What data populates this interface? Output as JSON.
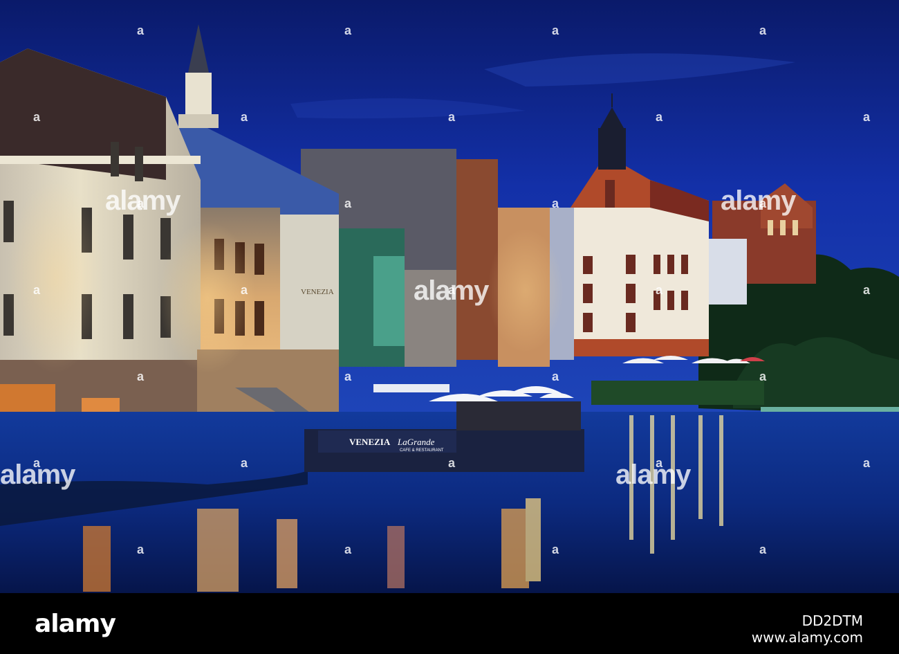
{
  "scene": {
    "signs": {
      "venezia_banner": "VENEZIA",
      "lagrande_banner": "LaGrande",
      "lagrande_sub": "CAFE & RESTAURANT",
      "venezia_facade": "VENEZIA"
    }
  },
  "watermark": {
    "brand": "alamy"
  },
  "footer": {
    "logo": "alamy",
    "image_id": "DD2DTM",
    "url": "www.alamy.com"
  }
}
